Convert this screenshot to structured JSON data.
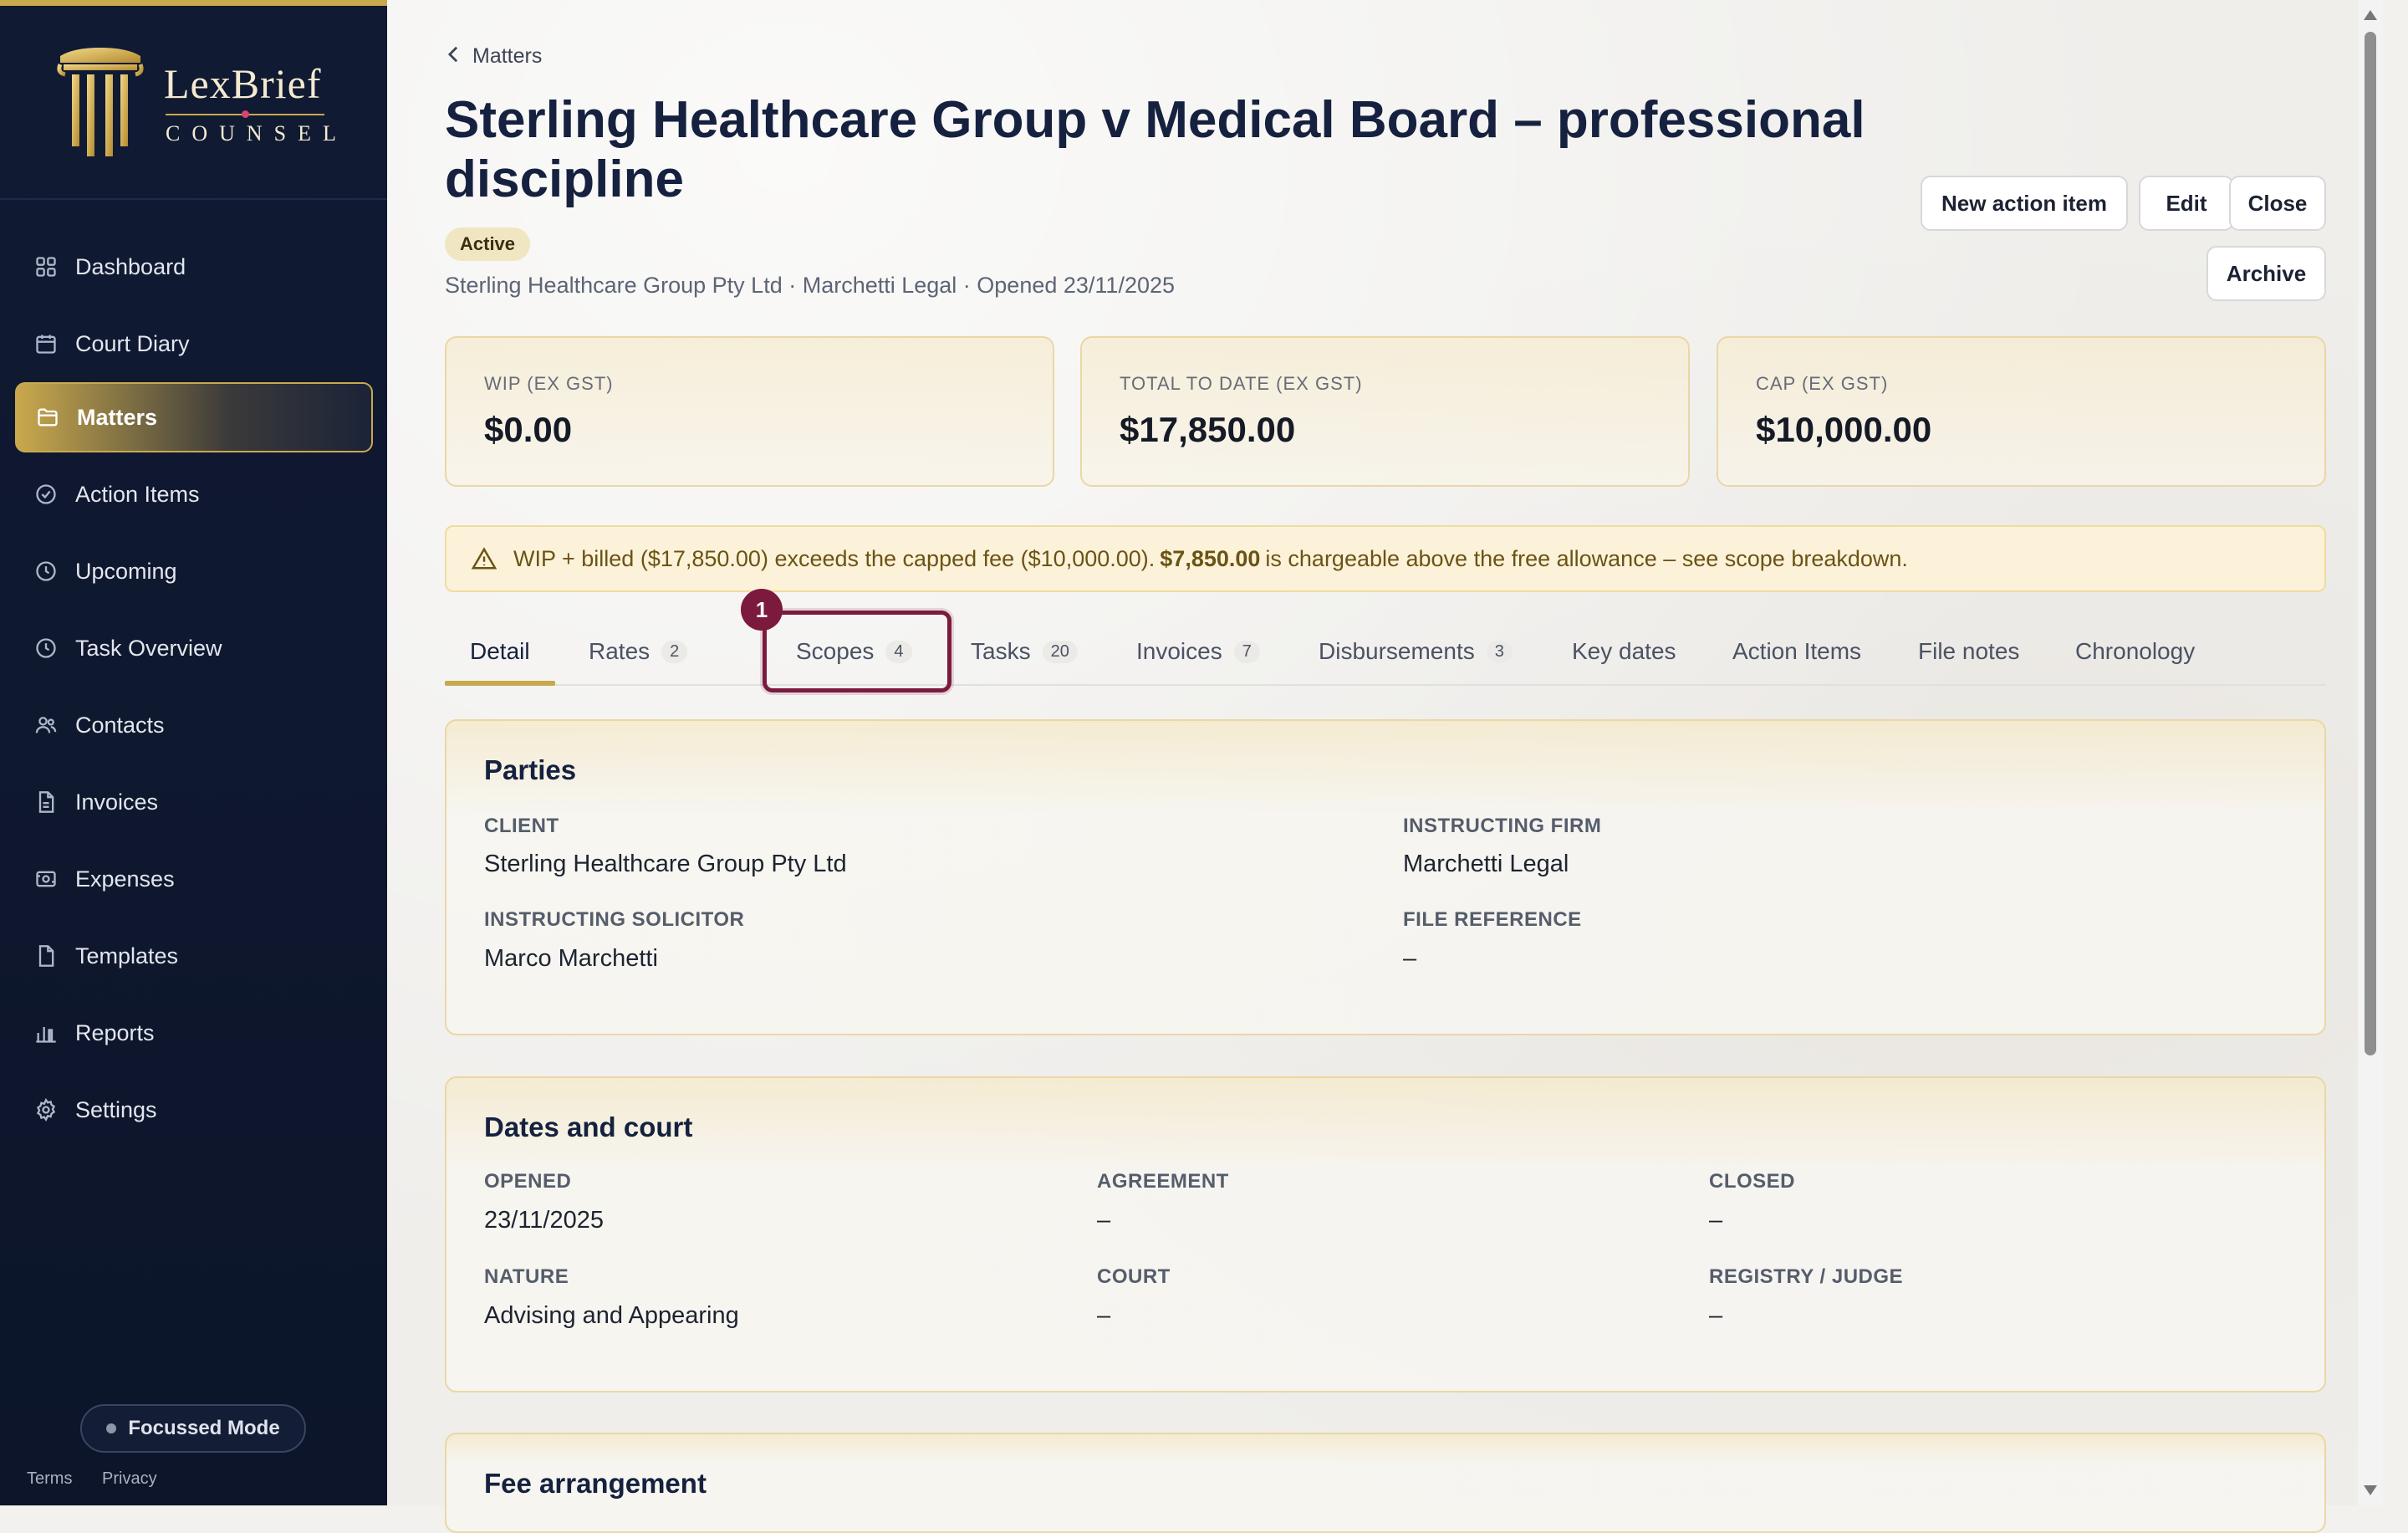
{
  "brand": {
    "name": "LexBrief",
    "sub": "COUNSEL"
  },
  "sidebar": {
    "items": [
      {
        "label": "Dashboard",
        "icon": "grid-icon"
      },
      {
        "label": "Court Diary",
        "icon": "calendar-icon"
      },
      {
        "label": "Matters",
        "icon": "folder-icon"
      },
      {
        "label": "Action Items",
        "icon": "check-circle-icon"
      },
      {
        "label": "Upcoming",
        "icon": "clock-icon"
      },
      {
        "label": "Task Overview",
        "icon": "clock-icon"
      },
      {
        "label": "Contacts",
        "icon": "users-icon"
      },
      {
        "label": "Invoices",
        "icon": "document-icon"
      },
      {
        "label": "Expenses",
        "icon": "receipt-icon"
      },
      {
        "label": "Templates",
        "icon": "file-icon"
      },
      {
        "label": "Reports",
        "icon": "bar-chart-icon"
      },
      {
        "label": "Settings",
        "icon": "gear-icon"
      }
    ],
    "active": "Matters",
    "focus_label": "Focussed Mode",
    "footer": {
      "terms": "Terms",
      "privacy": "Privacy"
    }
  },
  "breadcrumb": {
    "label": "Matters"
  },
  "matter": {
    "title": "Sterling Healthcare Group v Medical Board – professional discipline",
    "status": "Active",
    "meta": "Sterling Healthcare Group Pty Ltd · Marchetti Legal · Opened 23/11/2025"
  },
  "actions": {
    "new_action_item": "New action item",
    "edit": "Edit",
    "close": "Close",
    "archive": "Archive"
  },
  "stats": [
    {
      "label": "WIP (EX GST)",
      "value": "$0.00"
    },
    {
      "label": "TOTAL TO DATE (EX GST)",
      "value": "$17,850.00"
    },
    {
      "label": "CAP (EX GST)",
      "value": "$10,000.00"
    }
  ],
  "alert": {
    "prefix": "WIP + billed ($17,850.00) exceeds the capped fee ($10,000.00).",
    "amount": "$7,850.00",
    "suffix": "is chargeable above the free allowance – see scope breakdown."
  },
  "tabs": [
    {
      "label": "Detail",
      "count": ""
    },
    {
      "label": "Rates",
      "count": "2"
    },
    {
      "label": "Scopes",
      "count": "4"
    },
    {
      "label": "Tasks",
      "count": "20"
    },
    {
      "label": "Invoices",
      "count": "7"
    },
    {
      "label": "Disbursements",
      "count": "3"
    },
    {
      "label": "Key dates",
      "count": ""
    },
    {
      "label": "Action Items",
      "count": ""
    },
    {
      "label": "File notes",
      "count": ""
    },
    {
      "label": "Chronology",
      "count": ""
    }
  ],
  "active_tab": "Detail",
  "step_marker": "1",
  "parties": {
    "title": "Parties",
    "client_label": "CLIENT",
    "client": "Sterling Healthcare Group Pty Ltd",
    "firm_label": "INSTRUCTING FIRM",
    "firm": "Marchetti Legal",
    "solicitor_label": "INSTRUCTING SOLICITOR",
    "solicitor": "Marco Marchetti",
    "ref_label": "FILE REFERENCE",
    "ref": "–"
  },
  "dates": {
    "title": "Dates and court",
    "opened_label": "OPENED",
    "opened": "23/11/2025",
    "agreement_label": "AGREEMENT",
    "agreement": "–",
    "closed_label": "CLOSED",
    "closed": "–",
    "nature_label": "NATURE",
    "nature": "Advising and Appearing",
    "court_label": "COURT",
    "court": "–",
    "registry_label": "REGISTRY / JUDGE",
    "registry": "–"
  },
  "fee": {
    "title": "Fee arrangement"
  },
  "colors": {
    "sidebar_bg": "#0f1930",
    "accent_gold": "#c9a94d",
    "highlight": "#7b1a3c"
  }
}
